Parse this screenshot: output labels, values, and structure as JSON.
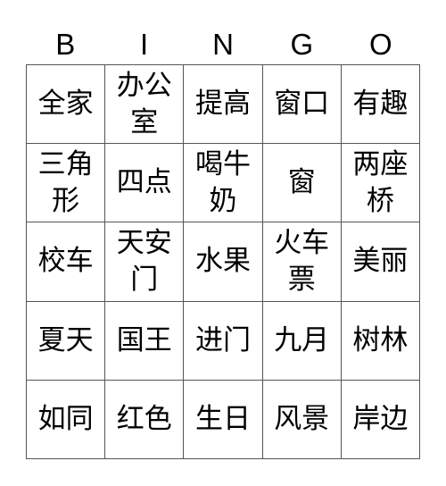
{
  "header": {
    "letters": [
      "B",
      "I",
      "N",
      "G",
      "O"
    ]
  },
  "grid": {
    "rows": [
      [
        "全家",
        "办公室",
        "提高",
        "窗口",
        "有趣"
      ],
      [
        "三角形",
        "四点",
        "喝牛奶",
        "窗",
        "两座桥"
      ],
      [
        "校车",
        "天安门",
        "水果",
        "火车票",
        "美丽"
      ],
      [
        "夏天",
        "国王",
        "进门",
        "九月",
        "树林"
      ],
      [
        "如同",
        "红色",
        "生日",
        "风景",
        "岸边"
      ]
    ]
  }
}
